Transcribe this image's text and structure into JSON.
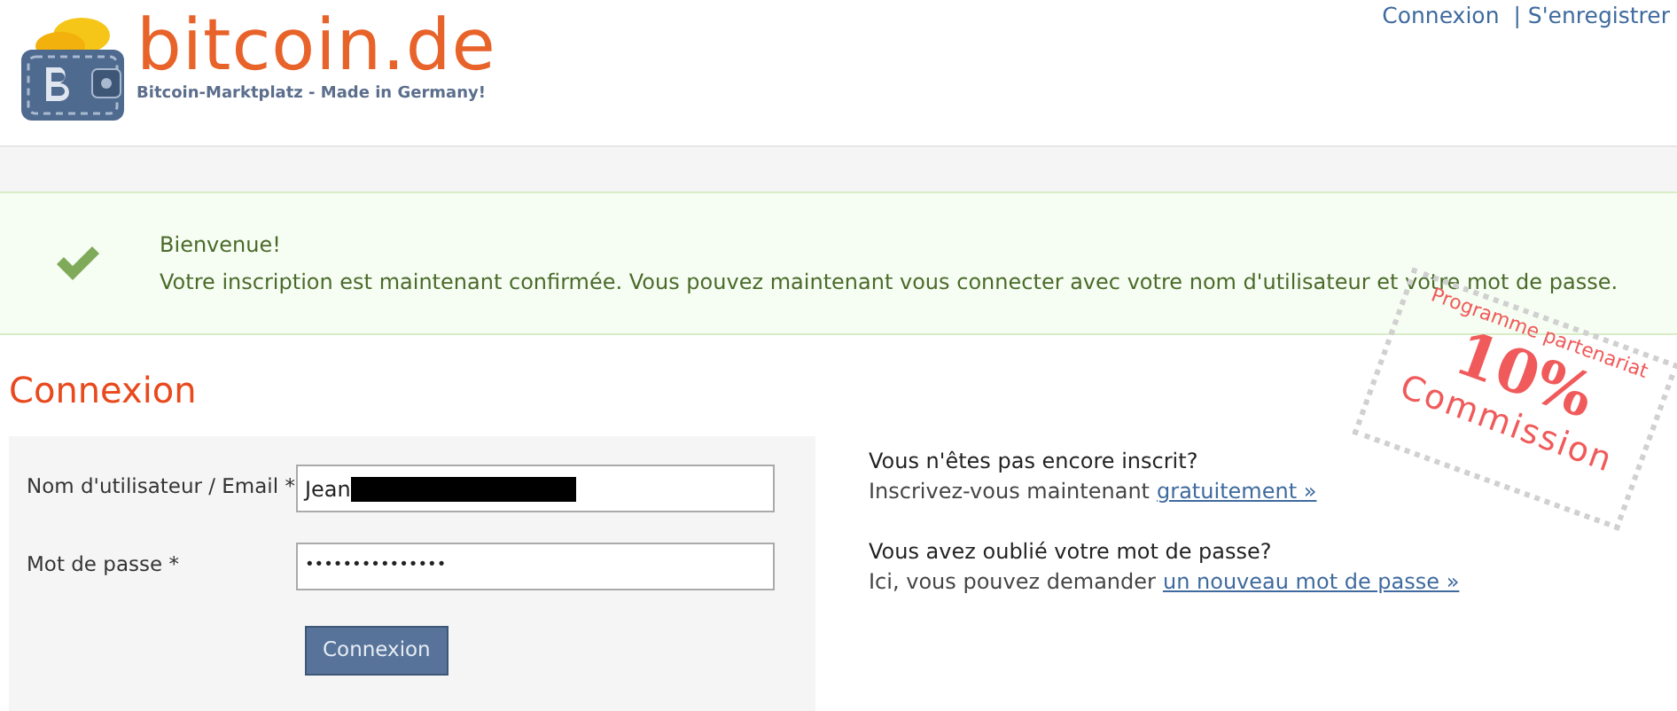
{
  "header": {
    "logo_text": "bitcoin.de",
    "tagline": "Bitcoin-Marktplatz - Made in Germany!",
    "links": [
      "Connexion",
      "| S'enregistrer"
    ]
  },
  "message": {
    "title": "Bienvenue!",
    "text": "Votre inscription est maintenant confirmée. Vous pouvez maintenant vous connecter avec votre nom d'utilisateur et votre mot de passe."
  },
  "stamp": {
    "line_1": "Programme partenariat",
    "line_2": "10%",
    "line_3": "Commission"
  },
  "login": {
    "title": "Connexion",
    "fields": [
      {
        "label": "Nom d'utilisateur / Email *",
        "value": "Jean",
        "redacted": true
      },
      {
        "label": "Mot de passe *",
        "value": "•••••••••••••••",
        "redacted": false
      }
    ],
    "button": "Connexion"
  },
  "help": [
    {
      "question": "Vous n'êtes pas encore inscrit?",
      "text": "Inscrivez-vous maintenant",
      "link": "gratuitement »"
    },
    {
      "question": "Vous avez oublié votre mot de passe?",
      "text": "Ici, vous pouvez demander",
      "link": "un nouveau mot de passe »"
    }
  ]
}
